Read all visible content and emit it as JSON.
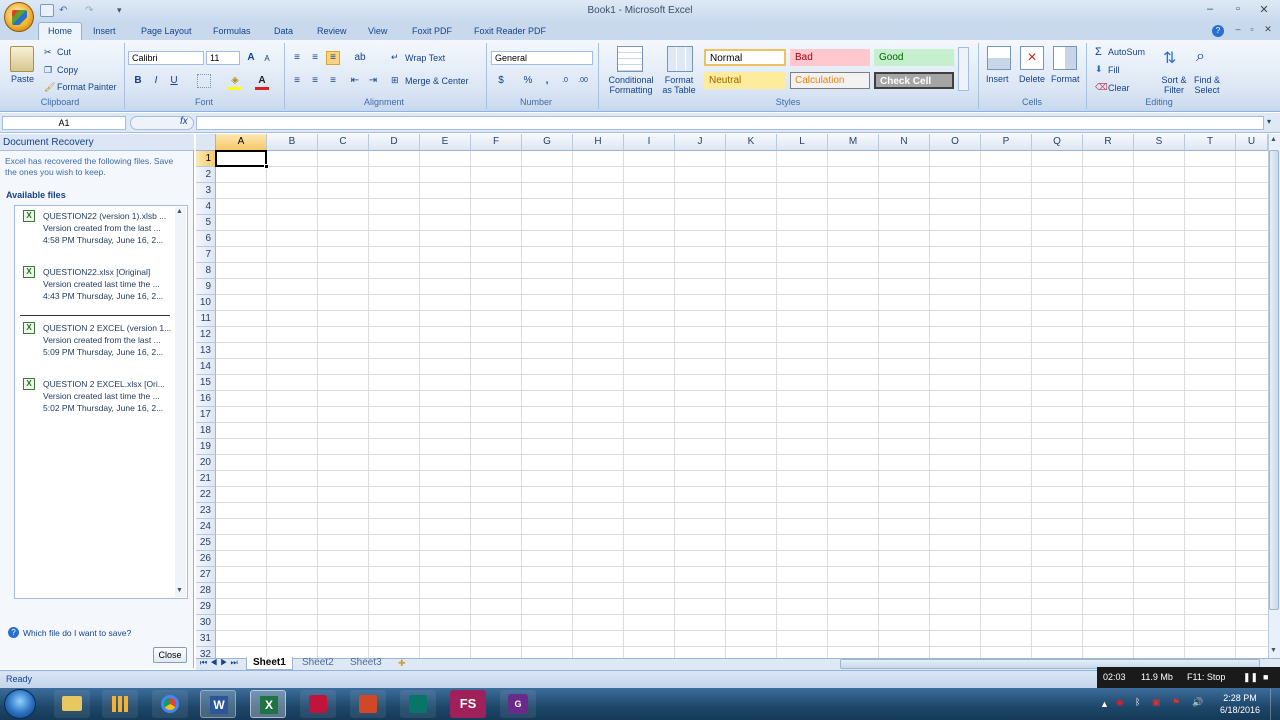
{
  "window": {
    "title": "Book1 - Microsoft Excel"
  },
  "ribbon_tabs": [
    "Home",
    "Insert",
    "Page Layout",
    "Formulas",
    "Data",
    "Review",
    "View",
    "Foxit PDF",
    "Foxit Reader PDF"
  ],
  "clipboard": {
    "paste": "Paste",
    "cut": "Cut",
    "copy": "Copy",
    "format_painter": "Format Painter",
    "label": "Clipboard"
  },
  "font": {
    "name": "Calibri",
    "size": "11",
    "label": "Font",
    "bold": "B",
    "italic": "I",
    "underline": "U",
    "grow": "A",
    "shrink": "A"
  },
  "alignment": {
    "wrap_text": "Wrap Text",
    "merge_center": "Merge & Center",
    "label": "Alignment"
  },
  "number": {
    "format": "General",
    "currency": "$",
    "percent": "%",
    "comma": ",",
    "label": "Number"
  },
  "styles_group": {
    "conditional": [
      "Conditional",
      "Formatting"
    ],
    "format_table": [
      "Format",
      "as Table"
    ],
    "label": "Styles",
    "cells": [
      "Normal",
      "Bad",
      "Good",
      "Neutral",
      "Calculation",
      "Check Cell"
    ]
  },
  "cells_group": {
    "insert": "Insert",
    "delete": "Delete",
    "format": "Format",
    "label": "Cells"
  },
  "editing": {
    "autosum": "AutoSum",
    "fill": "Fill",
    "clear": "Clear",
    "sort": [
      "Sort &",
      "Filter"
    ],
    "find": [
      "Find &",
      "Select"
    ],
    "label": "Editing"
  },
  "namebox": "A1",
  "fx": "fx",
  "recovery": {
    "title": "Document Recovery",
    "intro": "Excel has recovered the following files.  Save the ones you wish to keep.",
    "available": "Available files",
    "files": [
      {
        "name": "QUESTION22 (version 1).xlsb ...",
        "line2": "Version created from the last ...",
        "line3": "4:58 PM Thursday, June 16, 2..."
      },
      {
        "name": "QUESTION22.xlsx  [Original]",
        "line2": "Version created last time the ...",
        "line3": "4:43 PM Thursday, June 16, 2..."
      },
      {
        "name": "QUESTION 2 EXCEL (version 1...",
        "line2": "Version created from the last ...",
        "line3": "5:09 PM Thursday, June 16, 2..."
      },
      {
        "name": "QUESTION 2 EXCEL.xlsx  [Ori...",
        "line2": "Version created last time the ...",
        "line3": "5:02 PM Thursday, June 16, 2..."
      }
    ],
    "help": "Which file do I want to save?",
    "close": "Close"
  },
  "columns": [
    "A",
    "B",
    "C",
    "D",
    "E",
    "F",
    "G",
    "H",
    "I",
    "J",
    "K",
    "L",
    "M",
    "N",
    "O",
    "P",
    "Q",
    "R",
    "S",
    "T",
    "U"
  ],
  "rows": [
    "1",
    "2",
    "3",
    "4",
    "5",
    "6",
    "7",
    "8",
    "9",
    "10",
    "11",
    "12",
    "13",
    "14",
    "15",
    "16",
    "17",
    "18",
    "19",
    "20",
    "21",
    "22",
    "23",
    "24",
    "25",
    "26",
    "27",
    "28",
    "29",
    "30",
    "31",
    "32"
  ],
  "sheets": [
    "Sheet1",
    "Sheet2",
    "Sheet3"
  ],
  "status": "Ready",
  "recorder": {
    "time": "02:03",
    "size": "11.9 Mb",
    "stop": "F11: Stop"
  },
  "clock": {
    "time": "2:28 PM",
    "date": "6/18/2016"
  },
  "taskbar_fs": "FS"
}
